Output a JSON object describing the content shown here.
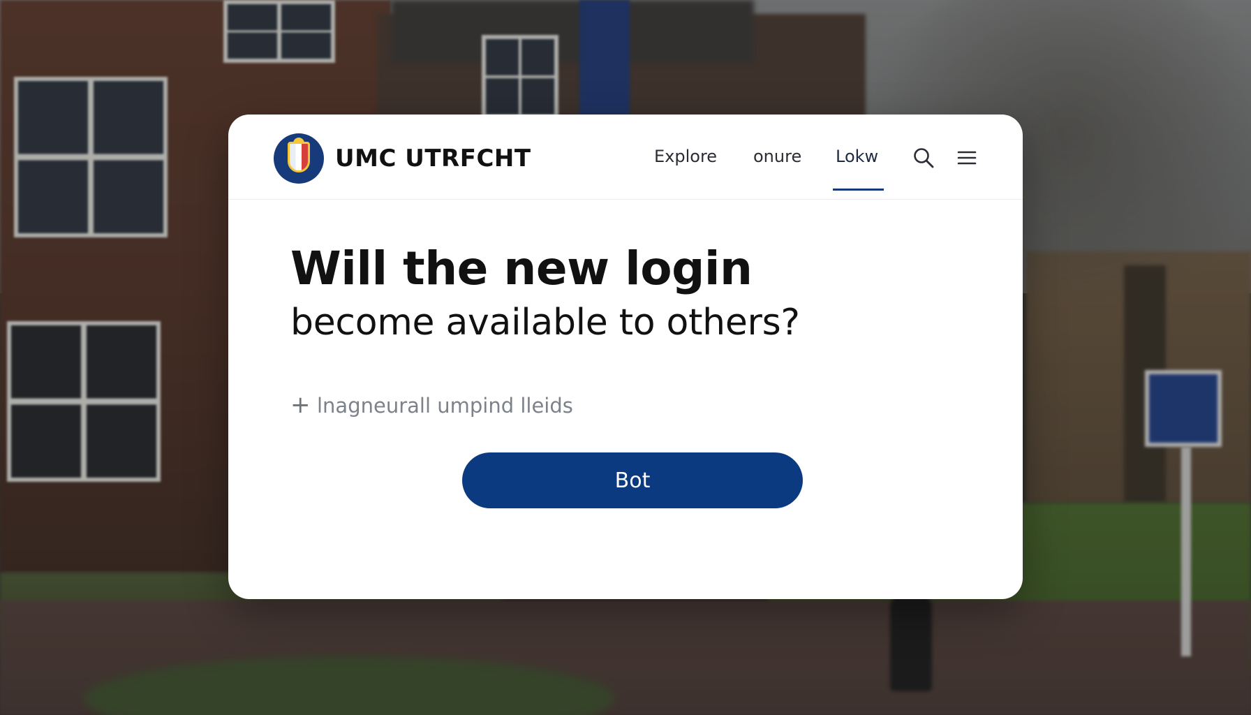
{
  "header": {
    "brand": "UMC UTRFCHT",
    "logo_icon": "university-shield-icon",
    "nav": [
      {
        "label": "Explore"
      },
      {
        "label": "onure"
      },
      {
        "label": "Lokw",
        "active": true
      }
    ],
    "search_icon": "search-icon",
    "menu_icon": "hamburger-menu-icon",
    "accent_color": "#173a7a"
  },
  "main": {
    "headline": "Will the new login",
    "subheadline": "become available to others?",
    "option": {
      "icon": "plus-icon",
      "label": "lnagneurall umpind lleids"
    },
    "primary_button": {
      "label": "Bot",
      "color": "#0c3a80"
    }
  }
}
